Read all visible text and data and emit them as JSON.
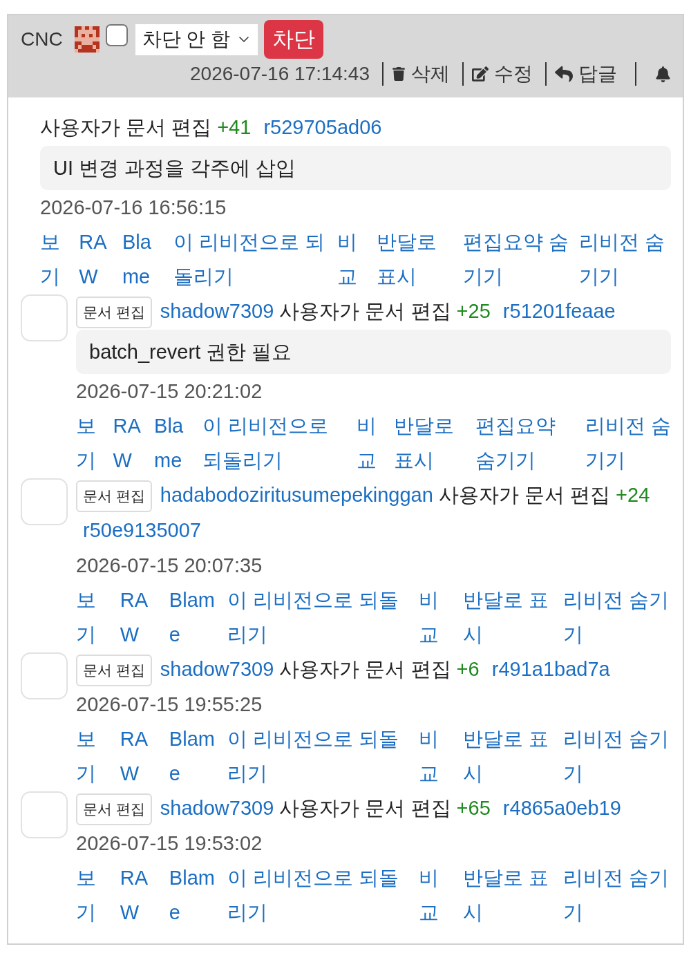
{
  "header": {
    "author": "CNC",
    "checkbox": {
      "checked": false
    },
    "block_select": {
      "value": "차단 안 함"
    },
    "block_button": "차단",
    "datetime": "2026-07-16 17:14:43",
    "actions": [
      {
        "kind": "delete",
        "label": "삭제"
      },
      {
        "kind": "edit",
        "label": "수정"
      },
      {
        "kind": "reply",
        "label": "답글"
      }
    ]
  },
  "latest_edit": {
    "action": "사용자가 문서 편집",
    "change": "+41",
    "revision": "r529705ad06",
    "summary": "UI 변경 과정을 각주에 삽입",
    "datetime": "2026-07-16 16:56:15",
    "links": [
      "보기",
      "RAW",
      "Blame",
      "이 리비전으로 되돌리기",
      "비교",
      "반달로 표시",
      "편집요약 숨기기",
      "리비전 숨기기"
    ]
  },
  "history": [
    {
      "badge": "문서 편집",
      "user": "shadow7309",
      "action": "사용자가 문서 편집",
      "change": "+25",
      "revision": "r51201feaae",
      "summary": "batch_revert 권한 필요",
      "datetime": "2026-07-15 20:21:02",
      "links": [
        "보기",
        "RAW",
        "Blame",
        "이 리비전으로 되돌리기",
        "비교",
        "반달로 표시",
        "편집요약 숨기기",
        "리비전 숨기기"
      ]
    },
    {
      "badge": "문서 편집",
      "user": "hadabodoziritusumepekinggan",
      "action": "사용자가 문서 편집",
      "change": "+24",
      "revision": "r50e9135007",
      "datetime": "2026-07-15 20:07:35",
      "links": [
        "보기",
        "RAW",
        "Blame",
        "이 리비전으로 되돌리기",
        "비교",
        "반달로 표시",
        "리비전 숨기기"
      ]
    },
    {
      "badge": "문서 편집",
      "user": "shadow7309",
      "action": "사용자가 문서 편집",
      "change": "+6",
      "revision": "r491a1bad7a",
      "datetime": "2026-07-15 19:55:25",
      "links": [
        "보기",
        "RAW",
        "Blame",
        "이 리비전으로 되돌리기",
        "비교",
        "반달로 표시",
        "리비전 숨기기"
      ]
    },
    {
      "badge": "문서 편집",
      "user": "shadow7309",
      "action": "사용자가 문서 편집",
      "change": "+65",
      "revision": "r4865a0eb19",
      "datetime": "2026-07-15 19:53:02",
      "links": [
        "보기",
        "RAW",
        "Blame",
        "이 리비전으로 되돌리기",
        "비교",
        "반달로 표시",
        "리비전 숨기기"
      ]
    }
  ]
}
